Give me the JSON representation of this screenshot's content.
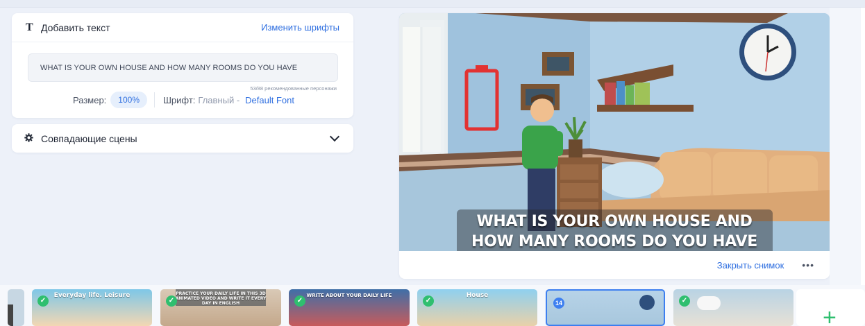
{
  "text_panel": {
    "title": "Добавить текст",
    "title_icon": "T",
    "change_fonts": "Изменить шрифты",
    "text_value": "WHAT IS YOUR OWN HOUSE AND HOW MANY ROOMS DO YOU HAVE",
    "counter": "53/88 рекомендованные персонажи",
    "size_label": "Размер:",
    "size_value": "100%",
    "font_label": "Шрифт:",
    "font_main": "Главный -",
    "font_name": "Default Font"
  },
  "scenes_panel": {
    "title": "Совпадающие сцены",
    "icon": "gear-icon"
  },
  "preview": {
    "caption_line1": "WHAT IS YOUR OWN HOUSE AND",
    "caption_line2": "HOW MANY ROOMS DO YOU HAVE",
    "close_snapshot": "Закрыть снимок",
    "more": "•••"
  },
  "timeline": {
    "thumbs": [
      {
        "label": "Everyday life. Leisure",
        "checked": true
      },
      {
        "label": "PRACTICE YOUR DAILY LIFE IN THIS 3D ANIMATED VIDEO AND WRITE IT EVERY DAY IN ENGLISH",
        "checked": true
      },
      {
        "label": "WRITE ABOUT YOUR DAILY LIFE",
        "checked": true
      },
      {
        "label": "House",
        "checked": true
      },
      {
        "label": "",
        "number": "14",
        "active": true
      },
      {
        "label": "",
        "checked": true
      }
    ],
    "add_label": "+"
  },
  "colors": {
    "accent": "#2f6fe0",
    "check": "#2fbf6f",
    "background": "#edf1f9"
  }
}
